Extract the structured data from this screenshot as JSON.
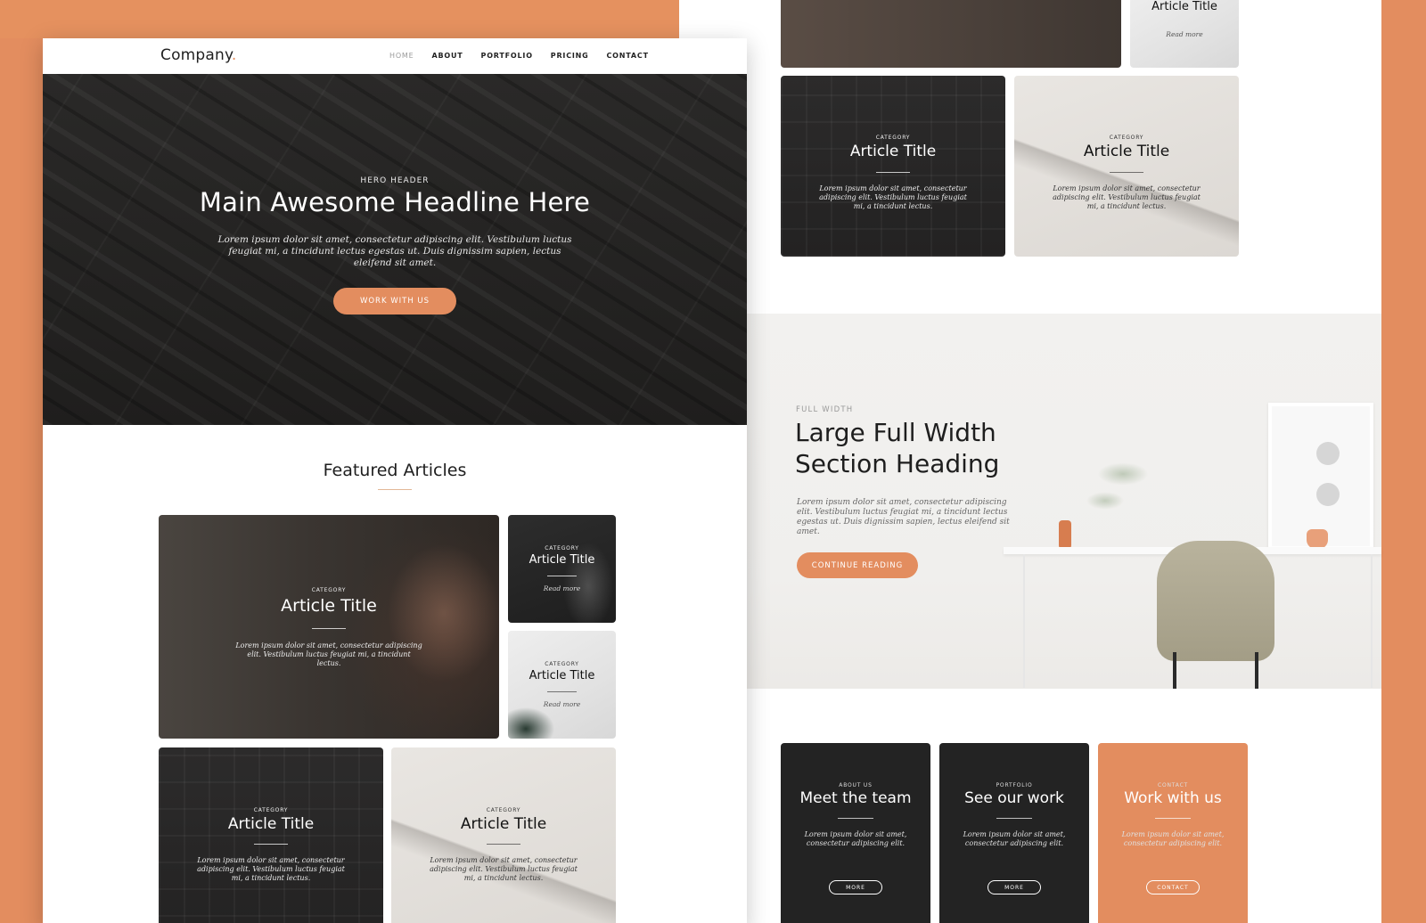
{
  "nav": {
    "logo": "Company",
    "logo_dot": ".",
    "links": [
      "HOME",
      "ABOUT",
      "PORTFOLIO",
      "PRICING",
      "CONTACT"
    ]
  },
  "hero": {
    "eyebrow": "HERO HEADER",
    "title": "Main Awesome Headline Here",
    "text": "Lorem ipsum dolor sit amet, consectetur adipiscing elit. Vestibulum luctus feugiat mi, a tincidunt lectus egestas ut. Duis dignissim sapien, lectus eleifend sit amet.",
    "button": "WORK WITH US"
  },
  "featured": {
    "title": "Featured Articles",
    "cards": [
      {
        "category": "CATEGORY",
        "title": "Article Title",
        "text": "Lorem ipsum dolor sit amet, consectetur adipiscing elit. Vestibulum luctus feugiat mi, a tincidunt lectus."
      },
      {
        "category": "CATEGORY",
        "title": "Article Title",
        "more": "Read more"
      },
      {
        "category": "CATEGORY",
        "title": "Article Title",
        "more": "Read more"
      },
      {
        "category": "CATEGORY",
        "title": "Article Title",
        "text": "Lorem ipsum dolor sit amet, consectetur adipiscing elit. Vestibulum luctus feugiat mi, a tincidunt lectus."
      },
      {
        "category": "CATEGORY",
        "title": "Article Title",
        "text": "Lorem ipsum dolor sit amet, consectetur adipiscing elit. Vestibulum luctus feugiat mi, a tincidunt lectus."
      }
    ]
  },
  "right": {
    "top_card": {
      "title": "Article Title",
      "more": "Read more"
    },
    "cards": [
      {
        "category": "CATEGORY",
        "title": "Article Title",
        "text": "Lorem ipsum dolor sit amet, consectetur adipiscing elit. Vestibulum luctus feugiat mi, a tincidunt lectus."
      },
      {
        "category": "CATEGORY",
        "title": "Article Title",
        "text": "Lorem ipsum dolor sit amet, consectetur adipiscing elit. Vestibulum luctus feugiat mi, a tincidunt lectus."
      }
    ],
    "fullwidth": {
      "eyebrow": "FULL WIDTH",
      "title": "Large Full Width Section Heading",
      "text": "Lorem ipsum dolor sit amet, consectetur adipiscing elit. Vestibulum luctus feugiat mi, a tincidunt lectus egestas ut. Duis dignissim sapien, lectus eleifend sit amet.",
      "button": "CONTINUE READING"
    },
    "services": [
      {
        "category": "ABOUT US",
        "title": "Meet the team",
        "text": "Lorem ipsum dolor sit amet, consectetur adipiscing elit.",
        "button": "MORE"
      },
      {
        "category": "PORTFOLIO",
        "title": "See our work",
        "text": "Lorem ipsum dolor sit amet, consectetur adipiscing elit.",
        "button": "MORE"
      },
      {
        "category": "CONTACT",
        "title": "Work with us",
        "text": "Lorem ipsum dolor sit amet, consectetur adipiscing elit.",
        "button": "CONTACT"
      }
    ]
  },
  "colors": {
    "accent": "#e38d5f",
    "dark": "#232323",
    "background": "#e38d5f"
  }
}
